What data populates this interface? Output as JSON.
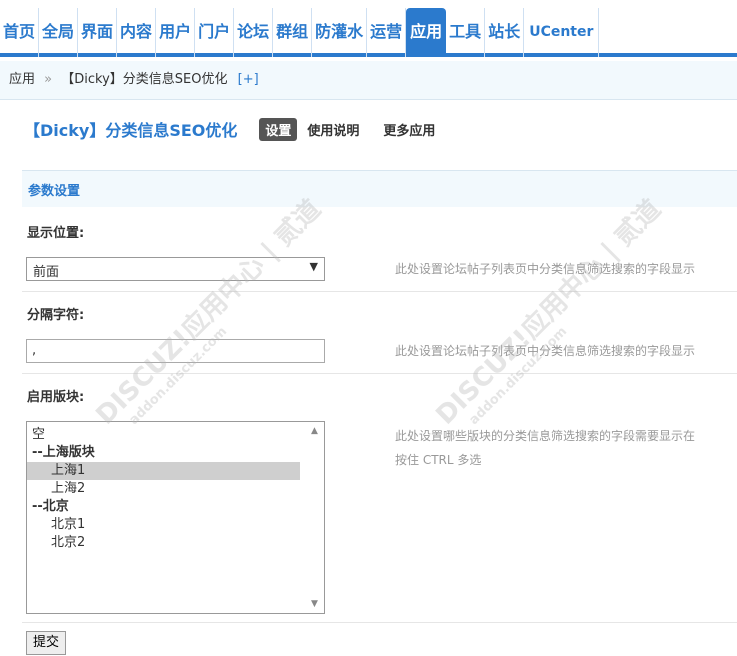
{
  "topnav": {
    "items": [
      "首页",
      "全局",
      "界面",
      "内容",
      "用户",
      "门户",
      "论坛",
      "群组",
      "防灌水",
      "运营",
      "应用",
      "工具",
      "站长",
      "UCenter"
    ],
    "active_index": 10
  },
  "breadcrumb": {
    "root": "应用",
    "separator": "»",
    "current": "【Dicky】分类信息SEO优化",
    "add": "[+]"
  },
  "plugin": {
    "title": "【Dicky】分类信息SEO优化",
    "tabs": [
      "设置",
      "使用说明",
      "更多应用"
    ]
  },
  "section": {
    "title": "参数设置"
  },
  "form": {
    "position": {
      "label": "显示位置:",
      "value": "前面",
      "tip": "此处设置论坛帖子列表页中分类信息筛选搜索的字段显示"
    },
    "separator": {
      "label": "分隔字符:",
      "value": ",",
      "tip": "此处设置论坛帖子列表页中分类信息筛选搜索的字段显示"
    },
    "forums": {
      "label": "启用版块:",
      "options": [
        {
          "text": "空",
          "kind": "plain",
          "selected": false
        },
        {
          "text": "--上海版块",
          "kind": "group",
          "selected": false
        },
        {
          "text": "上海1",
          "kind": "child",
          "selected": true
        },
        {
          "text": "上海2",
          "kind": "child",
          "selected": false
        },
        {
          "text": "--北京",
          "kind": "group",
          "selected": false
        },
        {
          "text": "北京1",
          "kind": "child",
          "selected": false
        },
        {
          "text": "北京2",
          "kind": "child",
          "selected": false
        }
      ],
      "tip1": "此处设置哪些版块的分类信息筛选搜索的字段需要显示在",
      "tip2": "按住 CTRL 多选"
    },
    "submit_label": "提交"
  },
  "watermark": {
    "main": "DISCUZ!应用中心 | 贰道",
    "sub": "addon.discuz.com"
  },
  "colors": {
    "accent": "#2b7acd",
    "section_bg": "#f2f9fd"
  }
}
